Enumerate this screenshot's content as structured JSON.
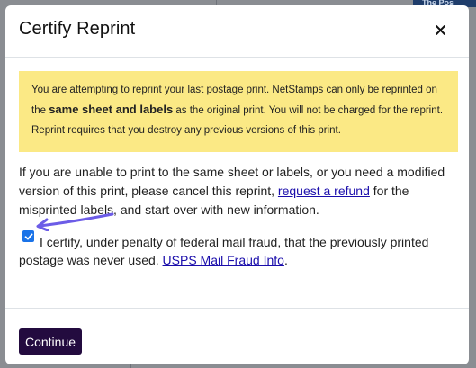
{
  "background": {
    "partial_text": "The Pos"
  },
  "modal": {
    "title": "Certify Reprint",
    "close_icon": "×",
    "alert": {
      "part1": "You are attempting to reprint your last postage print. NetStamps can only be reprinted on the ",
      "emphasis": "same sheet and labels",
      "part2": " as the original print. You will not be charged for the reprint. Reprint requires that you destroy any previous versions of this print."
    },
    "info": {
      "before_link": "If you are unable to print to the same sheet or labels, or you need a modified version of this print, please cancel this reprint, ",
      "link": "request a refund",
      "after_link": " for the misprinted labels, and start over with new information."
    },
    "certify": {
      "checked": true,
      "text": "I certify, under penalty of federal mail fraud, that the previously printed postage was never used. ",
      "link": "USPS Mail Fraud Info",
      "after_link": "."
    },
    "continue_button": "Continue"
  },
  "colors": {
    "alert_background": "#fbe985",
    "button_background": "#230b3f",
    "link": "#1a0dab",
    "arrow": "#6c5ce7",
    "checkbox": "#1a73e8"
  }
}
